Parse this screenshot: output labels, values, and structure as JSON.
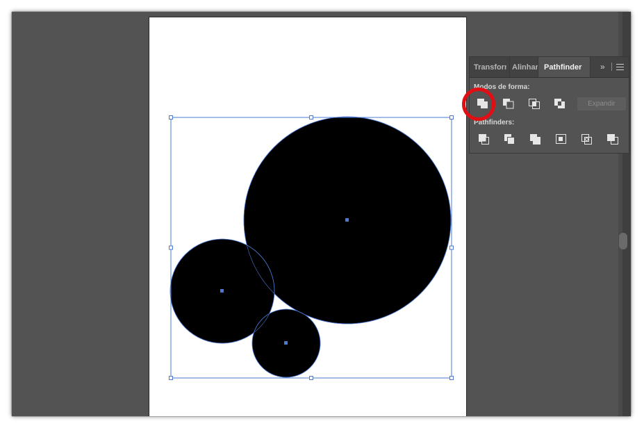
{
  "panel": {
    "tabs": {
      "transform": "Transform",
      "align": "Alinhar",
      "pathfinder": "Pathfinder"
    },
    "collapse_glyph": "»",
    "shape_modes_label": "Modos de forma:",
    "pathfinders_label": "Pathfinders:",
    "expand_label": "Expandir",
    "shape_mode_buttons": [
      "unite-icon",
      "minus-front-icon",
      "intersect-icon",
      "exclude-icon"
    ],
    "pathfinder_buttons": [
      "divide-icon",
      "trim-icon",
      "merge-icon",
      "crop-icon",
      "outline-icon",
      "minus-back-icon"
    ]
  },
  "canvas": {
    "fill_color": "#000000",
    "selection_color": "#4a78d4",
    "highlight_color": "#e10e14"
  }
}
